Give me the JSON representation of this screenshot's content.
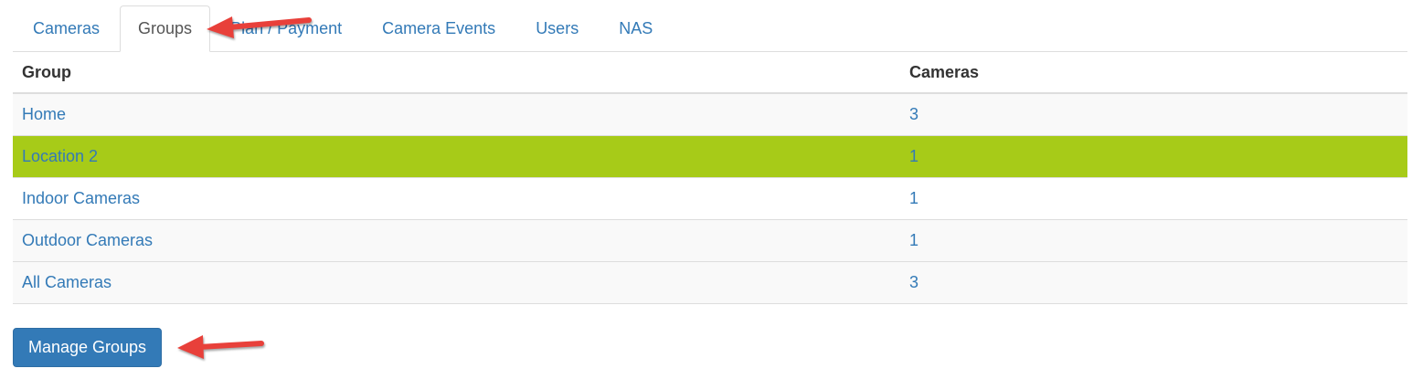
{
  "tabs": [
    {
      "label": "Cameras",
      "active": false
    },
    {
      "label": "Groups",
      "active": true
    },
    {
      "label": "Plan / Payment",
      "active": false
    },
    {
      "label": "Camera Events",
      "active": false
    },
    {
      "label": "Users",
      "active": false
    },
    {
      "label": "NAS",
      "active": false
    }
  ],
  "table": {
    "headers": {
      "group": "Group",
      "cameras": "Cameras"
    },
    "rows": [
      {
        "group": "Home",
        "cameras": "3",
        "selected": false
      },
      {
        "group": "Location 2",
        "cameras": "1",
        "selected": true
      },
      {
        "group": "Indoor Cameras",
        "cameras": "1",
        "selected": false
      },
      {
        "group": "Outdoor Cameras",
        "cameras": "1",
        "selected": false
      },
      {
        "group": "All Cameras",
        "cameras": "3",
        "selected": false
      }
    ]
  },
  "actions": {
    "manage_groups_label": "Manage Groups"
  },
  "annotations": {
    "arrow_color": "#e8403a"
  },
  "colors": {
    "link": "#337ab7",
    "selected_row": "#a7cb18",
    "button": "#337ab7"
  }
}
